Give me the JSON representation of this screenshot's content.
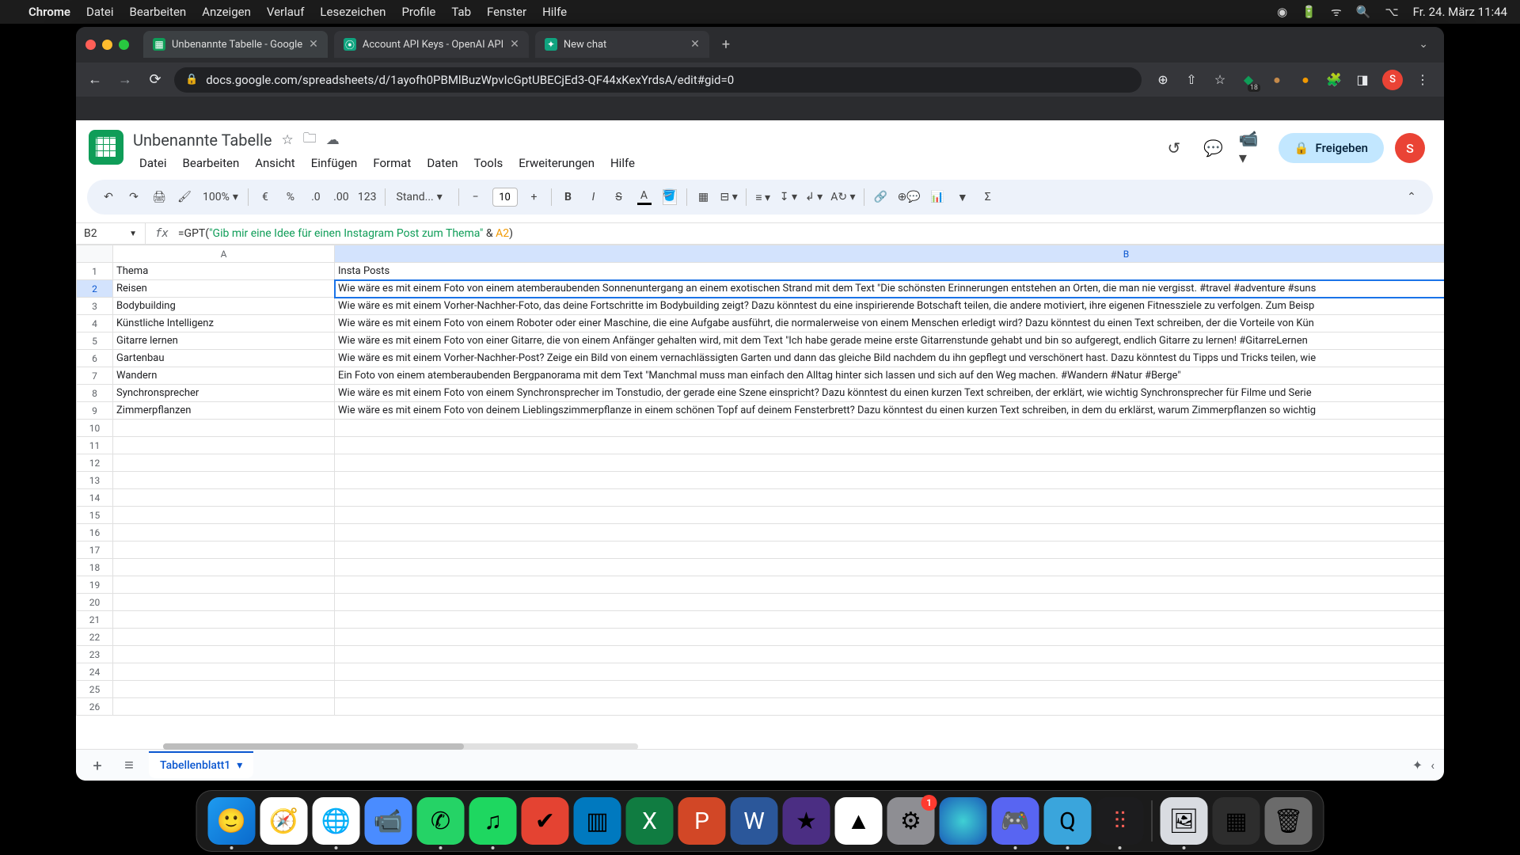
{
  "macos": {
    "app": "Chrome",
    "menus": [
      "Datei",
      "Bearbeiten",
      "Anzeigen",
      "Verlauf",
      "Lesezeichen",
      "Profile",
      "Tab",
      "Fenster",
      "Hilfe"
    ],
    "clock": "Fr. 24. März 11:44"
  },
  "chrome": {
    "tabs": [
      {
        "title": "Unbenannte Tabelle - Google",
        "favicon": "▦",
        "faviconBg": "#0f9d58",
        "active": true
      },
      {
        "title": "Account API Keys - OpenAI API",
        "favicon": "⦿",
        "faviconBg": "#10a37f",
        "active": false
      },
      {
        "title": "New chat",
        "favicon": "✦",
        "faviconBg": "#10a37f",
        "active": false
      }
    ],
    "url": "docs.google.com/spreadsheets/d/1ayofh0PBMlBuzWpvIcGptUBECjEd3-QF44xKexYrdsA/edit#gid=0",
    "ext_badge": "18",
    "avatar": "S"
  },
  "sheets": {
    "title": "Unbenannte Tabelle",
    "menus": [
      "Datei",
      "Bearbeiten",
      "Ansicht",
      "Einfügen",
      "Format",
      "Daten",
      "Tools",
      "Erweiterungen",
      "Hilfe"
    ],
    "share": "Freigeben",
    "avatar": "S",
    "zoom": "100%",
    "font": "Stand...",
    "fontsize": "10",
    "namebox": "B2",
    "formula_prefix": "=GPT(",
    "formula_string": "\"Gib mir eine Idee für einen Instagram Post zum Thema\"",
    "formula_concat": " & ",
    "formula_ref": "A2",
    "formula_suffix": ")",
    "col_headers": [
      "A",
      "B"
    ],
    "rows": [
      {
        "n": "1",
        "a": "Thema",
        "b": "Insta Posts"
      },
      {
        "n": "2",
        "a": "Reisen",
        "b": "Wie wäre es mit einem Foto von einem atemberaubenden Sonnenuntergang an einem exotischen Strand mit dem Text \"Die schönsten Erinnerungen entstehen an Orten, die man nie vergisst. #travel #adventure #suns"
      },
      {
        "n": "3",
        "a": "Bodybuilding",
        "b": "Wie wäre es mit einem Vorher-Nachher-Foto, das deine Fortschritte im Bodybuilding zeigt? Dazu könntest du eine inspirierende Botschaft teilen, die andere motiviert, ihre eigenen Fitnessziele zu verfolgen. Zum Beisp"
      },
      {
        "n": "4",
        "a": "Künstliche Intelligenz",
        "b": "Wie wäre es mit einem Foto von einem Roboter oder einer Maschine, die eine Aufgabe ausführt, die normalerweise von einem Menschen erledigt wird? Dazu könntest du einen Text schreiben, der die Vorteile von Kün"
      },
      {
        "n": "5",
        "a": "Gitarre lernen",
        "b": "Wie wäre es mit einem Foto von einer Gitarre, die von einem Anfänger gehalten wird, mit dem Text \"Ich habe gerade meine erste Gitarrenstunde gehabt und bin so aufgeregt, endlich Gitarre zu lernen! #GitarreLernen"
      },
      {
        "n": "6",
        "a": "Gartenbau",
        "b": "Wie wäre es mit einem Vorher-Nachher-Post? Zeige ein Bild von einem vernachlässigten Garten und dann das gleiche Bild nachdem du ihn gepflegt und verschönert hast. Dazu könntest du Tipps und Tricks teilen, wie"
      },
      {
        "n": "7",
        "a": "Wandern",
        "b": "Ein Foto von einem atemberaubenden Bergpanorama mit dem Text \"Manchmal muss man einfach den Alltag hinter sich lassen und sich auf den Weg machen. #Wandern #Natur #Berge\""
      },
      {
        "n": "8",
        "a": "Synchronsprecher",
        "b": "Wie wäre es mit einem Foto von einem Synchronsprecher im Tonstudio, der gerade eine Szene einspricht? Dazu könntest du einen kurzen Text schreiben, der erklärt, wie wichtig Synchronsprecher für Filme und Serie"
      },
      {
        "n": "9",
        "a": "Zimmerpflanzen",
        "b": "Wie wäre es mit einem Foto von deinem Lieblingszimmerpflanze in einem schönen Topf auf deinem Fensterbrett? Dazu könntest du einen kurzen Text schreiben, in dem du erklärst, warum Zimmerpflanzen so wichtig"
      }
    ],
    "empty_rows": [
      "10",
      "11",
      "12",
      "13",
      "14",
      "15",
      "16",
      "17",
      "18",
      "19",
      "20",
      "21",
      "22",
      "23",
      "24",
      "25",
      "26"
    ],
    "sheet_tab": "Tabellenblatt1"
  },
  "dock": {
    "badge_settings": "1"
  }
}
